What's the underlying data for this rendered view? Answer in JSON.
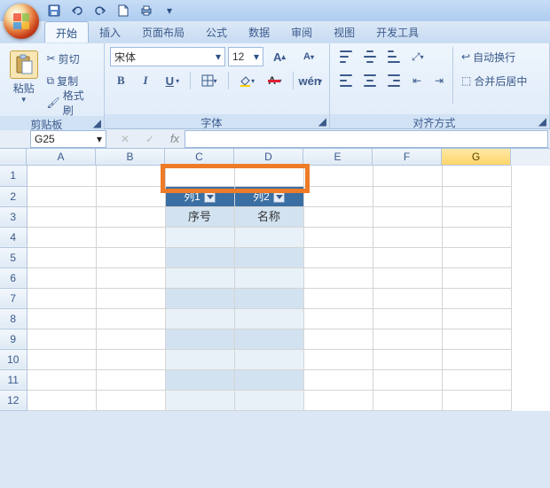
{
  "qat": {
    "save_title": "保存",
    "undo_title": "撤销",
    "redo_title": "恢复",
    "new_title": "新建",
    "print_title": "打印"
  },
  "tabs": {
    "home": "开始",
    "insert": "插入",
    "layout": "页面布局",
    "formula": "公式",
    "data": "数据",
    "review": "审阅",
    "view": "视图",
    "dev": "开发工具"
  },
  "clipboard": {
    "paste": "粘贴",
    "cut": "剪切",
    "copy": "复制",
    "format_painter": "格式刷",
    "group_label": "剪贴板"
  },
  "font": {
    "name": "宋体",
    "size": "12",
    "group_label": "字体"
  },
  "align": {
    "wrap": "自动换行",
    "merge": "合并后居中",
    "group_label": "对齐方式"
  },
  "namebox": {
    "ref": "G25"
  },
  "columns": [
    "A",
    "B",
    "C",
    "D",
    "E",
    "F",
    "G"
  ],
  "rows": [
    "1",
    "2",
    "3",
    "4",
    "5",
    "6",
    "7",
    "8",
    "9",
    "10",
    "11",
    "12"
  ],
  "table": {
    "header": [
      "列1",
      "列2"
    ],
    "row1": [
      "序号",
      "名称"
    ]
  },
  "chart_data": {
    "type": "table",
    "title": "",
    "columns": [
      "列1",
      "列2"
    ],
    "rows": [
      [
        "序号",
        "名称"
      ],
      [
        "",
        ""
      ],
      [
        "",
        ""
      ],
      [
        "",
        ""
      ],
      [
        "",
        ""
      ],
      [
        "",
        ""
      ],
      [
        "",
        ""
      ],
      [
        "",
        ""
      ],
      [
        "",
        ""
      ],
      [
        "",
        ""
      ]
    ]
  }
}
